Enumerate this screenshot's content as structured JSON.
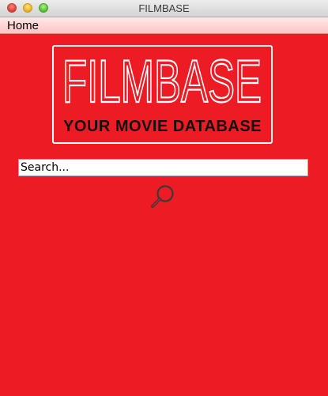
{
  "window": {
    "title": "FILMBASE"
  },
  "menu": {
    "home_label": "Home"
  },
  "logo": {
    "title": "FILMBASE",
    "subtitle": "YOUR MOVIE DATABASE"
  },
  "search": {
    "value": "Search..."
  },
  "colors": {
    "background": "#ed1c24",
    "logo_outline": "#ffffff",
    "subtitle_text": "#111111"
  },
  "icons": {
    "search_button": "magnifier-icon"
  }
}
